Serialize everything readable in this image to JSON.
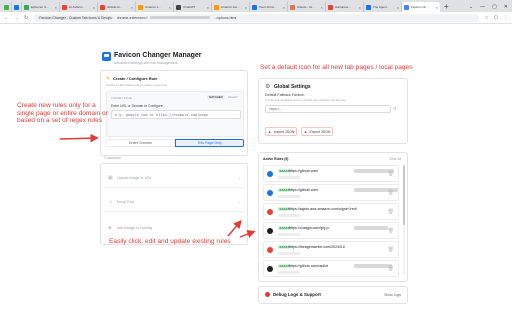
{
  "browser": {
    "tabs": [
      {
        "label": "",
        "color": "#4caf50"
      },
      {
        "label": "",
        "color": "#1a73e8"
      },
      {
        "label": "Ephemer G...",
        "color": "#34a853"
      },
      {
        "label": "Hi Ashkim...",
        "color": "#ea4335"
      },
      {
        "label": "GitHub-fo...",
        "color": "#ea4335"
      },
      {
        "label": "Amazon.c...",
        "color": "#ff9900"
      },
      {
        "label": "ChatGPT",
        "color": "#444444"
      },
      {
        "label": "Amazon Ast...",
        "color": "#ff9900"
      },
      {
        "label": "Team Drive...",
        "color": "#1a73e8"
      },
      {
        "label": "Claude - Gi...",
        "color": "#d97757"
      },
      {
        "label": "startuptox...",
        "color": "#ea4335"
      },
      {
        "label": "The Agent...",
        "color": "#1a73e8"
      },
      {
        "label": "Favicon Ch...",
        "color": "#4285f4"
      }
    ],
    "new_tab": "+",
    "window_controls": [
      "⌄",
      "—",
      "▢",
      "✕"
    ],
    "nav": [
      "←",
      "→",
      "↻"
    ],
    "site_chip": "Favicon Changer - Custom Tab Icons & Emojis",
    "url": "chrome-extension://",
    "url_tail": ".../options.html",
    "toolbar_icons": [
      "☆",
      "⬡",
      "⋮"
    ]
  },
  "app": {
    "title": "Favicon Changer Manager",
    "subtitle": "Advanced settings and rule management",
    "create_heading": "Create / Configure Rule",
    "create_sub": "Create a URL-based rule to create a new icon",
    "target_page_label": "TARGET PAGE",
    "match_selected": "MATCHED",
    "match_other": "REGEX",
    "url_field_label": "Enter URL or Domain to Configure",
    "url_placeholder": "e.g. google.com or https://example.com/page",
    "entire_domain_btn": "Entire Domain",
    "this_page_btn": "This Page Only",
    "customize_heading": "Customize",
    "customize_rows": [
      "Upload Image or URL",
      "Emoji Grid",
      "Add Badge or Overlay"
    ],
    "global_title": "Global Settings",
    "default_favicon_label": "Default Fallback Favicon",
    "default_favicon_sub": "If a site has no favicon and no specific rule matches, use this one",
    "default_placeholder": "https://...",
    "import_btn": "Import JSON",
    "export_btn": "Export JSON",
    "active_rules_label": "Active Rules (9)",
    "clear_all": "Clear All",
    "rules": [
      {
        "url": "https://github.com/",
        "icon_color": "#1a73e8",
        "match": "EXACT"
      },
      {
        "url": "https://github.com/",
        "icon_color": "#1a73e8",
        "match": "EXACT"
      },
      {
        "url": "https://signin.aws.amazon.com/signin?redi",
        "icon_color": "#ea4335",
        "match": "EXACT"
      },
      {
        "url": "https://chatgpt.com/g/g-p-",
        "icon_color": "#202124",
        "match": "EXACT"
      },
      {
        "url": "https://theagentwriter.com/2024/01/",
        "icon_color": "#ea4335",
        "match": "EXACT"
      },
      {
        "url": "https://github.com/rapilot",
        "icon_color": "#202124",
        "match": "EXACT"
      }
    ],
    "debug_title": "Debug Logs & Support",
    "show_logs": "Show Logs"
  },
  "annotations": {
    "left": "Create new rules only for a single page or entire domain or based on a set of regex rules",
    "top_right": "Set a default icon for all new tab pages / local pages",
    "bottom": "Easily click, edit and update existing rules"
  },
  "colors": {
    "annotation": "#e53935",
    "accent": "#1a73e8",
    "badge_green": "#d7f5dd",
    "import_red": "#e53935"
  }
}
